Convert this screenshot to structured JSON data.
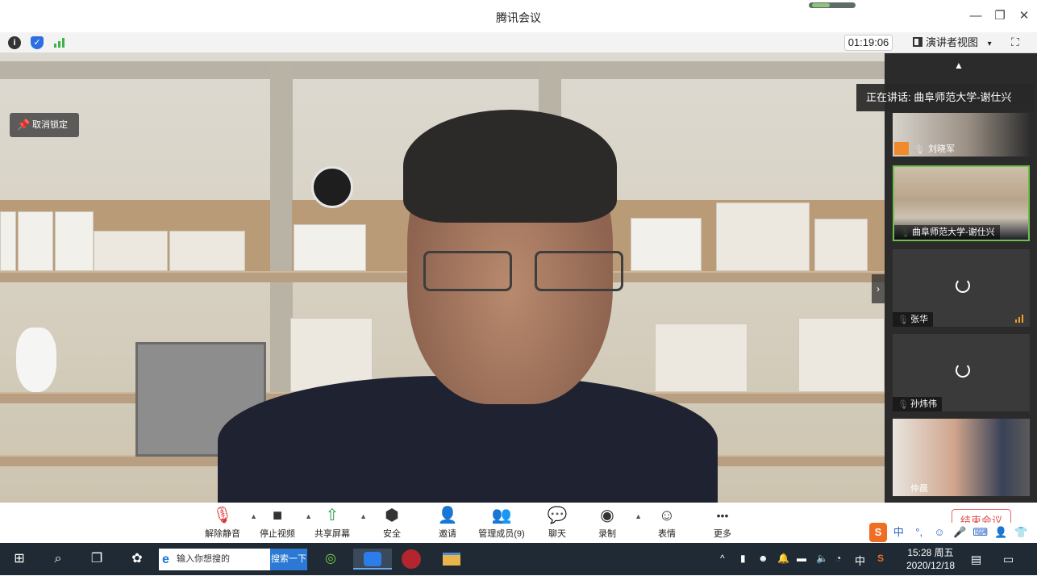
{
  "window": {
    "title": "腾讯会议",
    "minimize": "—",
    "restore": "❐",
    "close": "✕"
  },
  "infobar": {
    "timer": "01:19:06",
    "view_mode": "演讲者视图",
    "view_caret": "▾",
    "fullscreen": "⛶"
  },
  "main_video": {
    "unlock_label": "取消锁定"
  },
  "speaking_label": "正在讲话: 曲阜师范大学-谢仕兴",
  "participants": [
    {
      "name": "刘晓军",
      "video": true
    },
    {
      "name": "曲阜师范大学-谢仕兴",
      "video": true,
      "active": true
    },
    {
      "name": "张华",
      "video": false
    },
    {
      "name": "孙炜伟",
      "video": false
    },
    {
      "name": "仲晨",
      "video": true
    }
  ],
  "toolbar": {
    "items": [
      {
        "label": "解除静音",
        "icon": "muted-mic-icon",
        "glyph": "🎙"
      },
      {
        "label": "停止视频",
        "icon": "video-camera-icon",
        "glyph": "■"
      },
      {
        "label": "共享屏幕",
        "icon": "share-screen-icon",
        "glyph": "⇧"
      },
      {
        "label": "安全",
        "icon": "shield-icon",
        "glyph": "⬢"
      },
      {
        "label": "邀请",
        "icon": "add-user-icon",
        "glyph": "👤"
      },
      {
        "label": "管理成员(9)",
        "icon": "members-icon",
        "glyph": "👥"
      },
      {
        "label": "聊天",
        "icon": "chat-icon",
        "glyph": "💬"
      },
      {
        "label": "录制",
        "icon": "record-icon",
        "glyph": "◉"
      },
      {
        "label": "表情",
        "icon": "emoji-icon",
        "glyph": "☺"
      },
      {
        "label": "更多",
        "icon": "more-icon",
        "glyph": "•••"
      }
    ],
    "end_meeting": "结束会议"
  },
  "ime": {
    "items": [
      "中",
      "°,",
      "☺",
      "🎤",
      "⌨",
      "👤",
      "👕",
      "▦"
    ]
  },
  "taskbar": {
    "search_placeholder": "输入你想搜的",
    "search_button": "搜索一下",
    "tray_ime": "中",
    "time": "15:28 周五",
    "date": "2020/12/18"
  }
}
